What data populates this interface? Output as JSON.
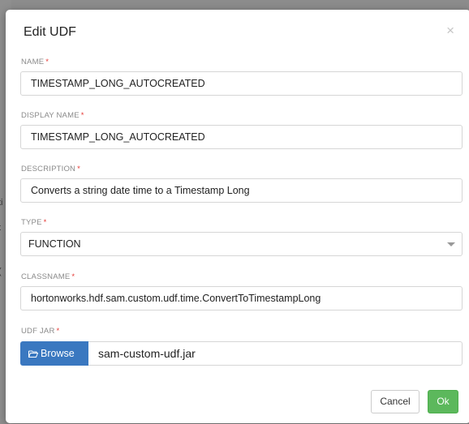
{
  "backdrop": {
    "fragments": [
      "ti",
      "t",
      "("
    ]
  },
  "modal": {
    "title": "Edit UDF",
    "close_symbol": "×"
  },
  "fields": {
    "name": {
      "label": "NAME",
      "required": "*",
      "value": "TIMESTAMP_LONG_AUTOCREATED"
    },
    "display_name": {
      "label": "DISPLAY NAME",
      "required": "*",
      "value": "TIMESTAMP_LONG_AUTOCREATED"
    },
    "description": {
      "label": "DESCRIPTION",
      "required": "*",
      "value": "Converts a string date time to a Timestamp Long"
    },
    "type": {
      "label": "TYPE",
      "required": "*",
      "value": "FUNCTION"
    },
    "classname": {
      "label": "CLASSNAME",
      "required": "*",
      "value": "hortonworks.hdf.sam.custom.udf.time.ConvertToTimestampLong"
    },
    "udf_jar": {
      "label": "UDF JAR",
      "required": "*",
      "browse_label": "Browse",
      "file_name": "sam-custom-udf.jar"
    }
  },
  "footer": {
    "cancel_label": "Cancel",
    "ok_label": "Ok"
  },
  "colors": {
    "primary": "#3a78c0",
    "success": "#5cb85c",
    "required": "#e53935"
  }
}
